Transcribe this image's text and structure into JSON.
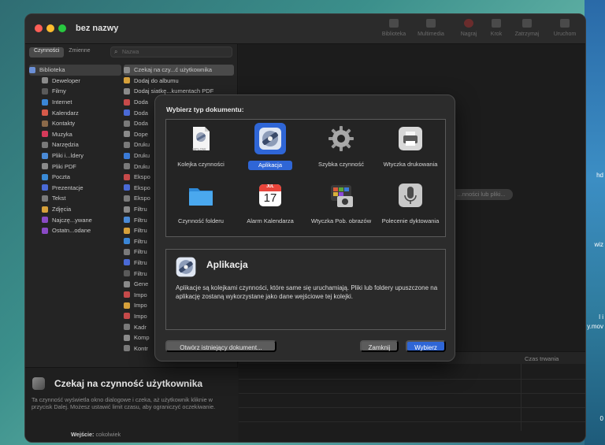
{
  "window": {
    "title": "bez nazwy"
  },
  "toolbar": [
    {
      "label": "Biblioteka",
      "icon": "library-icon"
    },
    {
      "label": "Multimedia",
      "icon": "media-icon"
    },
    {
      "label": "Nagraj",
      "icon": "record-icon"
    },
    {
      "label": "Krok",
      "icon": "step-icon"
    },
    {
      "label": "Zatrzymaj",
      "icon": "stop-icon"
    },
    {
      "label": "Uruchom",
      "icon": "run-icon"
    }
  ],
  "left_tabs": [
    "Czynności",
    "Zmienne"
  ],
  "search": {
    "placeholder": "Nazwa"
  },
  "library": [
    {
      "label": "Biblioteka",
      "color": "#6b8fd6",
      "selected": true
    },
    {
      "label": "Deweloper",
      "color": "#8a8a8a"
    },
    {
      "label": "Filmy",
      "color": "#5a5a5a"
    },
    {
      "label": "Internet",
      "color": "#3a86d6"
    },
    {
      "label": "Kalendarz",
      "color": "#d65a4a"
    },
    {
      "label": "Kontakty",
      "color": "#8b6a4a"
    },
    {
      "label": "Muzyka",
      "color": "#d63a5a"
    },
    {
      "label": "Narzędzia",
      "color": "#7a7a7a"
    },
    {
      "label": "Pliki i...ldery",
      "color": "#4a8ad6"
    },
    {
      "label": "Pliki PDF",
      "color": "#8a8a8a"
    },
    {
      "label": "Poczta",
      "color": "#3a8ad6"
    },
    {
      "label": "Prezentacje",
      "color": "#4a6ad6"
    },
    {
      "label": "Tekst",
      "color": "#7a7a7a"
    },
    {
      "label": "Zdjęcia",
      "color": "#d6a03a"
    },
    {
      "label": "Najczę...ywane",
      "color": "#8a4ac6"
    },
    {
      "label": "Ostatn...odane",
      "color": "#8a4ac6"
    }
  ],
  "actions": [
    {
      "label": "Czekaj na czy...ć użytkownika",
      "color": "#8a8a8a",
      "selected": true
    },
    {
      "label": "Dodaj do albumu",
      "color": "#d6a03a"
    },
    {
      "label": "Dodaj siatkę...kumentach PDF",
      "color": "#8a8a8a"
    },
    {
      "label": "Doda",
      "color": "#c64a4a"
    },
    {
      "label": "Doda",
      "color": "#4a6ad6"
    },
    {
      "label": "Doda",
      "color": "#7a7a7a"
    },
    {
      "label": "Dope",
      "color": "#8a8a8a"
    },
    {
      "label": "Druku",
      "color": "#7a7a7a"
    },
    {
      "label": "Druku",
      "color": "#3a7ad6"
    },
    {
      "label": "Druku",
      "color": "#7a7a7a"
    },
    {
      "label": "Ekspo",
      "color": "#c64a4a"
    },
    {
      "label": "Ekspo",
      "color": "#4a6ad6"
    },
    {
      "label": "Ekspo",
      "color": "#7a7a7a"
    },
    {
      "label": "Filtru",
      "color": "#8a8a8a"
    },
    {
      "label": "Filtru",
      "color": "#4a8ad6"
    },
    {
      "label": "Filtru",
      "color": "#d6a03a"
    },
    {
      "label": "Filtru",
      "color": "#3a86d6"
    },
    {
      "label": "Filtru",
      "color": "#7a7a7a"
    },
    {
      "label": "Filtru",
      "color": "#4a6ad6"
    },
    {
      "label": "Filtru",
      "color": "#5a5a5a"
    },
    {
      "label": "Gene",
      "color": "#8a8a8a"
    },
    {
      "label": "Impo",
      "color": "#c64a4a"
    },
    {
      "label": "Impo",
      "color": "#d6a03a"
    },
    {
      "label": "Impo",
      "color": "#c64a4a"
    },
    {
      "label": "Kadr",
      "color": "#7a7a7a"
    },
    {
      "label": "Komp",
      "color": "#8a8a8a"
    },
    {
      "label": "Kontr",
      "color": "#7a7a7a"
    }
  ],
  "description": {
    "title": "Czekaj na czynność użytkownika",
    "body": "Ta czynność wyświetla okno dialogowe i czeka, aż użytkownik kliknie w przycisk Dalej. Możesz ustawić limit czasu, aby ograniczyć oczekiwanie.",
    "input_label": "Wejście:",
    "input_value": "cokolwiek"
  },
  "canvas": {
    "hint": "...nności lub pliki..."
  },
  "log": {
    "duration_header": "Czas trwania"
  },
  "dialog": {
    "title": "Wybierz typ dokumentu:",
    "types": [
      {
        "label": "Kolejka czynności",
        "icon": "workflow-document-icon",
        "selected": false
      },
      {
        "label": "Aplikacja",
        "icon": "automator-application-icon",
        "selected": true
      },
      {
        "label": "Szybka czynność",
        "icon": "gear-icon",
        "selected": false
      },
      {
        "label": "Wtyczka drukowania",
        "icon": "printer-icon",
        "selected": false
      },
      {
        "label": "Czynność folderu",
        "icon": "folder-icon",
        "selected": false
      },
      {
        "label": "Alarm Kalendarza",
        "icon": "calendar-icon",
        "selected": false
      },
      {
        "label": "Wtyczka Pob. obrazów",
        "icon": "image-capture-icon",
        "selected": false
      },
      {
        "label": "Polecenie dyktowania",
        "icon": "microphone-icon",
        "selected": false
      }
    ],
    "calendar_month": "JUL",
    "calendar_day": "17",
    "workflow_tag": "WFLOW",
    "info": {
      "title": "Aplikacja",
      "text": "Aplikacje są kolejkami czynności, które same się uruchamiają. Pliki lub foldery upuszczone na aplikację zostaną wykorzystane jako dane wejściowe tej kolejki."
    },
    "buttons": {
      "open": "Otwórz istniejący dokument...",
      "close": "Zamknij",
      "choose": "Wybierz"
    }
  },
  "desktop_edge": [
    "hd",
    "wiz",
    "l i",
    "y.mov",
    "0"
  ]
}
